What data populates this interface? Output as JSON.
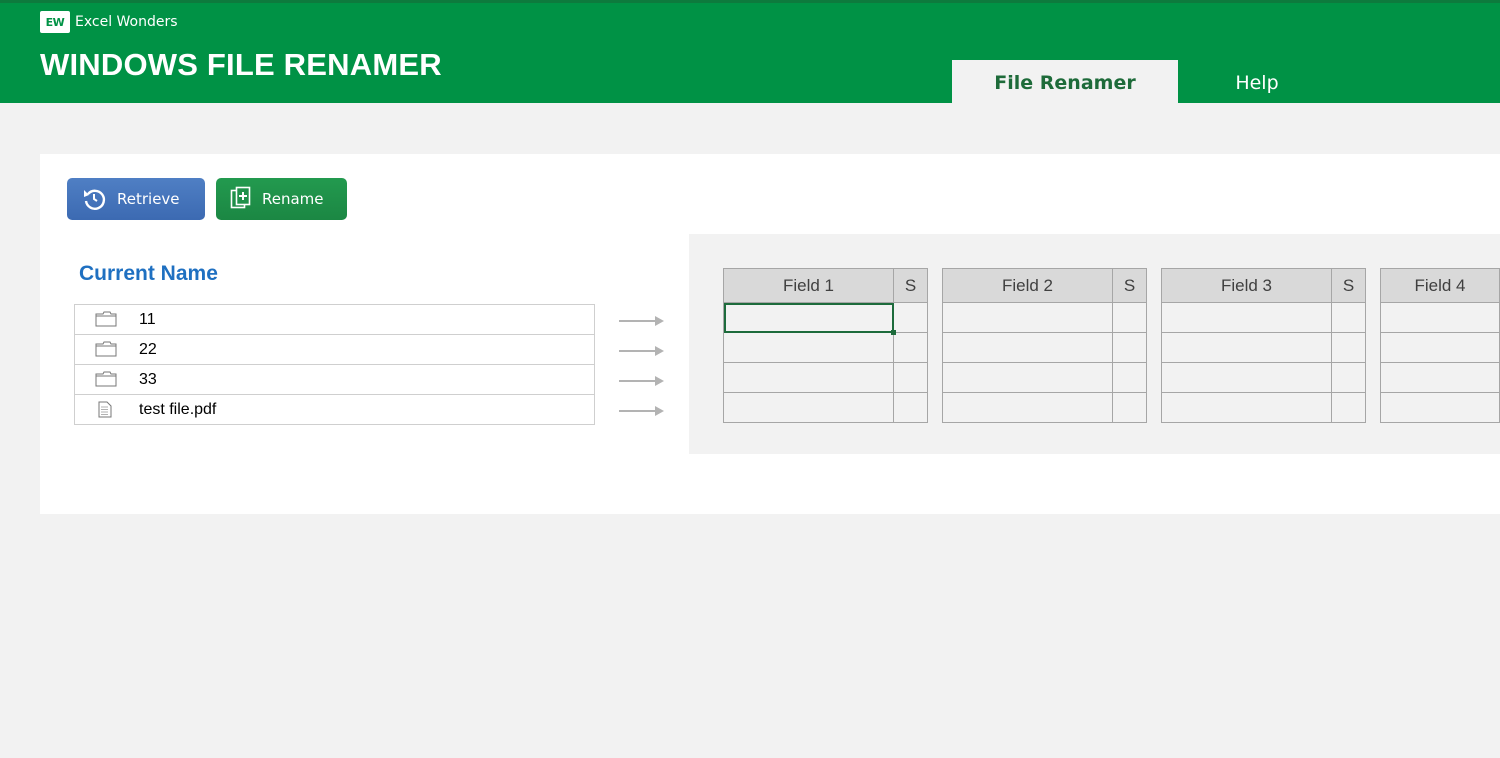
{
  "brand": {
    "logo": "EW",
    "name": "Excel Wonders"
  },
  "app_title": "WINDOWS FILE RENAMER",
  "tabs": [
    {
      "label": "File Renamer",
      "active": true
    },
    {
      "label": "Help",
      "active": false
    }
  ],
  "buttons": {
    "retrieve": {
      "label": "Retrieve",
      "icon": "refresh-icon"
    },
    "rename": {
      "label": "Rename",
      "icon": "add-file-icon"
    }
  },
  "current_name_label": "Current Name",
  "files": [
    {
      "name": "11",
      "type": "folder"
    },
    {
      "name": "22",
      "type": "folder"
    },
    {
      "name": "33",
      "type": "folder"
    },
    {
      "name": "test file.pdf",
      "type": "file"
    }
  ],
  "fields": [
    {
      "header": "Field 1",
      "sep_header": "S"
    },
    {
      "header": "Field 2",
      "sep_header": "S"
    },
    {
      "header": "Field 3",
      "sep_header": "S"
    },
    {
      "header": "Field 4"
    }
  ],
  "colors": {
    "header_bg": "#009245",
    "retrieve_button": "#4575ba",
    "rename_button": "#1f914a",
    "current_name_label": "#1f70c1"
  }
}
